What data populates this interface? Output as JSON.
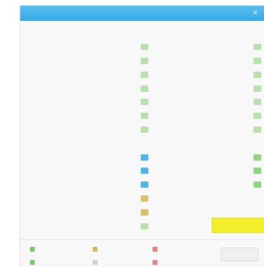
{
  "window": {
    "title": "",
    "close_glyph": "×"
  },
  "left_list": [
    {
      "label": "",
      "swatch": "none"
    },
    {
      "label": "",
      "swatch": "green"
    },
    {
      "label": "",
      "swatch": "green"
    },
    {
      "label": "",
      "swatch": "green"
    },
    {
      "label": "",
      "swatch": "green"
    },
    {
      "label": "",
      "swatch": "green"
    },
    {
      "label": "",
      "swatch": "green"
    },
    {
      "label": "",
      "swatch": "green"
    },
    {
      "label": "",
      "swatch": "none"
    },
    {
      "label": "",
      "swatch": "blue"
    },
    {
      "label": "",
      "swatch": "blue"
    },
    {
      "label": "",
      "swatch": "blue"
    },
    {
      "label": "",
      "swatch": "gold"
    },
    {
      "label": "",
      "swatch": "gold"
    },
    {
      "label": "",
      "swatch": "green"
    }
  ],
  "right_list": [
    {
      "label": "",
      "swatch": "none"
    },
    {
      "label": "",
      "swatch": "green"
    },
    {
      "label": "",
      "swatch": "green"
    },
    {
      "label": "",
      "swatch": "green"
    },
    {
      "label": "",
      "swatch": "green"
    },
    {
      "label": "",
      "swatch": "green"
    },
    {
      "label": "",
      "swatch": "green"
    },
    {
      "label": "",
      "swatch": "green"
    },
    {
      "label": "",
      "swatch": "none"
    },
    {
      "label": "",
      "swatch": "green2"
    },
    {
      "label": "",
      "swatch": "green2"
    },
    {
      "label": "",
      "swatch": "green2"
    },
    {
      "label": "",
      "swatch": "none"
    }
  ],
  "note_text": "",
  "action_button_label": "",
  "legend": [
    {
      "label": "",
      "color": "green"
    },
    {
      "label": "",
      "color": "gold"
    },
    {
      "label": "",
      "color": "red"
    },
    {
      "label": "",
      "color": "green"
    },
    {
      "label": "",
      "color": "grey"
    },
    {
      "label": "",
      "color": "red"
    }
  ],
  "ok_button_label": "",
  "colors": {
    "titlebar": "#34a8e4",
    "swatch_green": "#b8dfae",
    "swatch_blue": "#4fb4e6",
    "swatch_gold": "#d6bf68",
    "action_button": "#f2ee2a"
  }
}
